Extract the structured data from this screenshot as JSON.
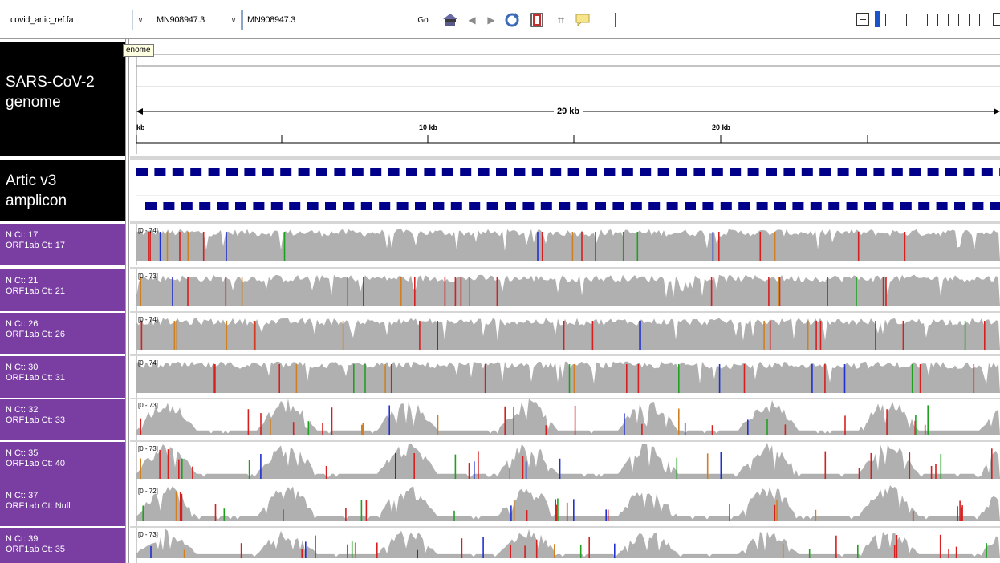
{
  "toolbar": {
    "genome_select": "covid_artic_ref.fa",
    "chromosome_select": "MN908947.3",
    "locus_input": "MN908947.3",
    "go_label": "Go"
  },
  "tooltip": "enome",
  "ruler": {
    "span_label": "29 kb",
    "tick_left": "kb",
    "tick_10": "10 kb",
    "tick_20": "20 kb"
  },
  "tracks": {
    "genome": {
      "line1": "SARS-CoV-2",
      "line2": "genome"
    },
    "amplicon": {
      "line1": "Artic v3",
      "line2": "amplicon"
    }
  },
  "samples": [
    {
      "line1": "N Ct: 17",
      "line2": "ORF1ab Ct: 17",
      "range": "[0 - 74]",
      "depth": "high"
    },
    {
      "line1": "N Ct: 21",
      "line2": "ORF1ab Ct: 21",
      "range": "[0 - 73]",
      "depth": "high"
    },
    {
      "line1": "N Ct: 26",
      "line2": "ORF1ab Ct: 26",
      "range": "[0 - 74]",
      "depth": "high"
    },
    {
      "line1": "N Ct: 30",
      "line2": "ORF1ab Ct: 31",
      "range": "[0 - 74]",
      "depth": "high"
    },
    {
      "line1": "N Ct: 32",
      "line2": "ORF1ab Ct: 33",
      "range": "[0 - 73]",
      "depth": "low"
    },
    {
      "line1": "N Ct: 35",
      "line2": "ORF1ab Ct: 40",
      "range": "[0 - 73]",
      "depth": "low"
    },
    {
      "line1": "N Ct: 37",
      "line2": "ORF1ab Ct: Null",
      "range": "[0 - 72]",
      "depth": "low"
    },
    {
      "line1": "N Ct: 39",
      "line2": "ORF1ab Ct: 35",
      "range": "[0 - 73]",
      "depth": "low"
    }
  ],
  "colors": {
    "coverage": "#b0b0b0",
    "amplicon": "#00008b",
    "sample_label_bg": "#7a3ea3",
    "track_label_bg": "#000000",
    "variant_red": "#d62020",
    "variant_blue": "#2030d0",
    "variant_green": "#20a020",
    "variant_orange": "#d08020"
  }
}
